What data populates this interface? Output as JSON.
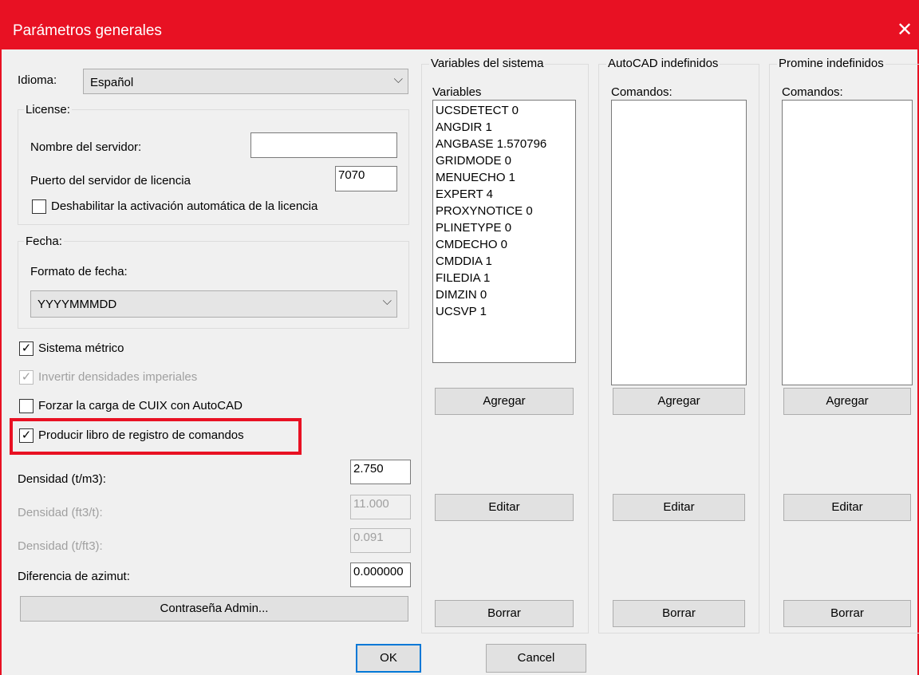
{
  "window": {
    "title": "Parámetros generales",
    "close_glyph": "✕"
  },
  "language": {
    "label": "Idioma:",
    "value": "Español"
  },
  "license": {
    "title": "License:",
    "server_name_label": "Nombre del servidor:",
    "server_name_value": "",
    "port_label": "Puerto del servidor de licencia",
    "port_value": "7070",
    "disable_auto_activation_label": "Deshabilitar la activación automática de la licencia",
    "disable_auto_activation_checked": false
  },
  "date": {
    "title": "Fecha:",
    "format_label": "Formato de fecha:",
    "format_value": "YYYYMMMDD"
  },
  "options": {
    "metric_label": "Sistema métrico",
    "metric_checked": true,
    "invert_densities_label": "Invertir densidades imperiales",
    "invert_densities_checked": true,
    "force_cuix_label": "Forzar la carga de CUIX con AutoCAD",
    "force_cuix_checked": false,
    "command_log_label": "Producir libro de registro de comandos",
    "command_log_checked": true
  },
  "densities": {
    "t_m3_label": "Densidad (t/m3):",
    "t_m3_value": "2.750",
    "ft3_t_label": "Densidad (ft3/t):",
    "ft3_t_value": "11.000",
    "t_ft3_label": "Densidad (t/ft3):",
    "t_ft3_value": "0.091",
    "azimuth_label": "Diferencia de azimut:",
    "azimuth_value": "0.000000"
  },
  "admin_password_button": "Contraseña Admin...",
  "system_variables": {
    "title": "Variables del sistema",
    "list_label": "Variables",
    "items": [
      "UCSDETECT 0",
      "ANGDIR 1",
      "ANGBASE 1.570796",
      "GRIDMODE 0",
      "MENUECHO 1",
      "EXPERT 4",
      "PROXYNOTICE 0",
      "PLINETYPE 0",
      "CMDECHO 0",
      "CMDDIA 1",
      "FILEDIA 1",
      "DIMZIN 0",
      "UCSVP 1"
    ],
    "add": "Agregar",
    "edit": "Editar",
    "delete": "Borrar"
  },
  "autocad_undefined": {
    "title": "AutoCAD indefinidos",
    "list_label": "Comandos:",
    "add": "Agregar",
    "edit": "Editar",
    "delete": "Borrar"
  },
  "promine_undefined": {
    "title": "Promine indefinidos",
    "list_label": "Comandos:",
    "add": "Agregar",
    "edit": "Editar",
    "delete": "Borrar"
  },
  "footer": {
    "ok": "OK",
    "cancel": "Cancel"
  },
  "icons": {
    "check": "✓",
    "chevron_down": "⌵"
  },
  "colors": {
    "titlebar": "#e81123",
    "highlight": "#e81123",
    "default_button_border": "#0078d7"
  }
}
